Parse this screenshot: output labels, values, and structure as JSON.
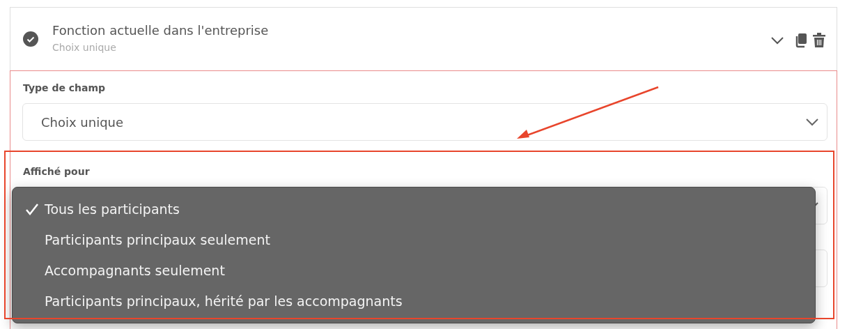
{
  "question": {
    "title": "Fonction actuelle dans l'entreprise",
    "subtitle": "Choix unique"
  },
  "fields": [
    {
      "label": "Type de champ",
      "value": "Choix unique"
    },
    {
      "label": "Affiché pour"
    }
  ],
  "dropdown": {
    "options": [
      {
        "label": "Tous les participants",
        "selected": true
      },
      {
        "label": "Participants principaux seulement",
        "selected": false
      },
      {
        "label": "Accompagnants seulement",
        "selected": false
      },
      {
        "label": "Participants principaux, hérité par les accompagnants",
        "selected": false
      }
    ]
  }
}
